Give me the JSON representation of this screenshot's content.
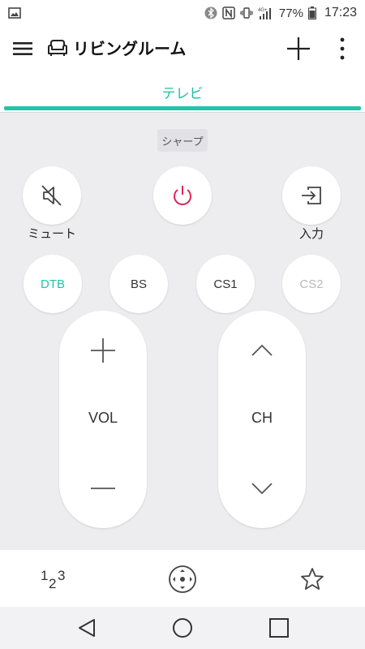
{
  "status_bar": {
    "battery_percent": "77%",
    "time": "17:23",
    "network_badge": "4G+",
    "icons": [
      "gallery-icon",
      "bluetooth-icon",
      "nfc-icon",
      "vibrate-icon",
      "signal-icon",
      "battery-icon"
    ]
  },
  "app_bar": {
    "title": "リビングルーム",
    "icons": [
      "menu-icon",
      "sofa-icon",
      "plus-icon",
      "more-vert-icon"
    ]
  },
  "tabs": [
    {
      "label": "テレビ",
      "selected": true
    }
  ],
  "colors": {
    "accent": "#25c2a8",
    "power": "#e0245e",
    "background": "#ededf0",
    "disabled": "#b9b9bd"
  },
  "remote": {
    "brand": "シャープ",
    "mute_label": "ミュート",
    "input_label": "入力",
    "sources": [
      {
        "label": "DTB",
        "state": "active"
      },
      {
        "label": "BS",
        "state": "normal"
      },
      {
        "label": "CS1",
        "state": "normal"
      },
      {
        "label": "CS2",
        "state": "disabled"
      }
    ],
    "volume_label": "VOL",
    "channel_label": "CH"
  },
  "bottom_bar": {
    "numpad_label": "123",
    "icons": [
      "numpad-icon",
      "dpad-icon",
      "favorite-star-icon"
    ]
  },
  "nav_bar": {
    "icons": [
      "back-icon",
      "home-icon",
      "recents-icon"
    ]
  }
}
